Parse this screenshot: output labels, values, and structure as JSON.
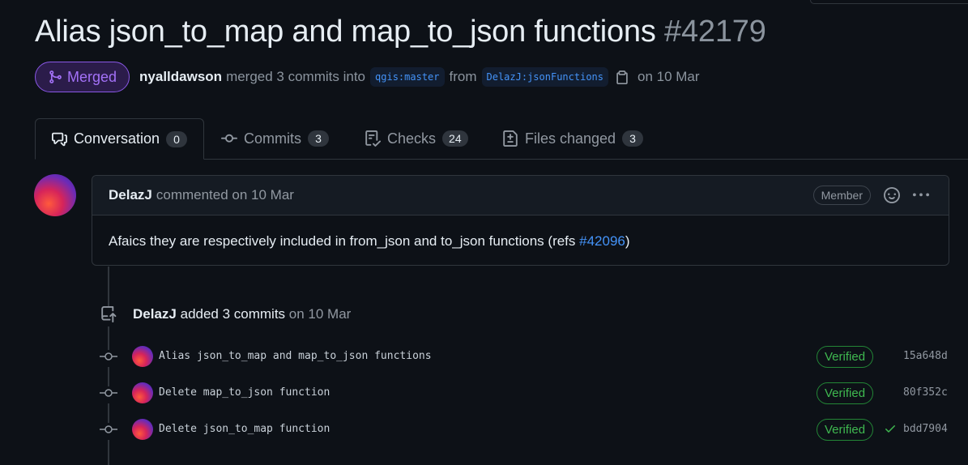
{
  "pr": {
    "title": "Alias json_to_map and map_to_json functions",
    "number": "#42179",
    "state": "Merged",
    "author": "nyalldawson",
    "merge_text": "merged 3 commits into",
    "base_branch": "qgis:master",
    "from_text": "from",
    "head_branch": "DelazJ:jsonFunctions",
    "date_text": "on 10 Mar"
  },
  "tabs": [
    {
      "label": "Conversation",
      "count": "0"
    },
    {
      "label": "Commits",
      "count": "3"
    },
    {
      "label": "Checks",
      "count": "24"
    },
    {
      "label": "Files changed",
      "count": "3"
    }
  ],
  "comment": {
    "author": "DelazJ",
    "meta": "commented on 10 Mar",
    "role": "Member",
    "body_before": "Afaics they are respectively included in from_json and to_json functions (refs ",
    "ref_link": "#42096",
    "body_after": ")"
  },
  "event": {
    "author": "DelazJ",
    "action": "added 3 commits",
    "date": "on 10 Mar"
  },
  "commits": [
    {
      "message": "Alias json_to_map and map_to_json functions",
      "badge": "Verified",
      "sha": "15a648d"
    },
    {
      "message": "Delete map_to_json function",
      "badge": "Verified",
      "sha": "80f352c"
    },
    {
      "message": "Delete json_to_map function",
      "badge": "Verified",
      "sha": "bdd7904"
    }
  ],
  "colors": {
    "background": "#0d1117",
    "merged": "#a371f7",
    "link": "#4493f8",
    "verified": "#3fb950"
  }
}
